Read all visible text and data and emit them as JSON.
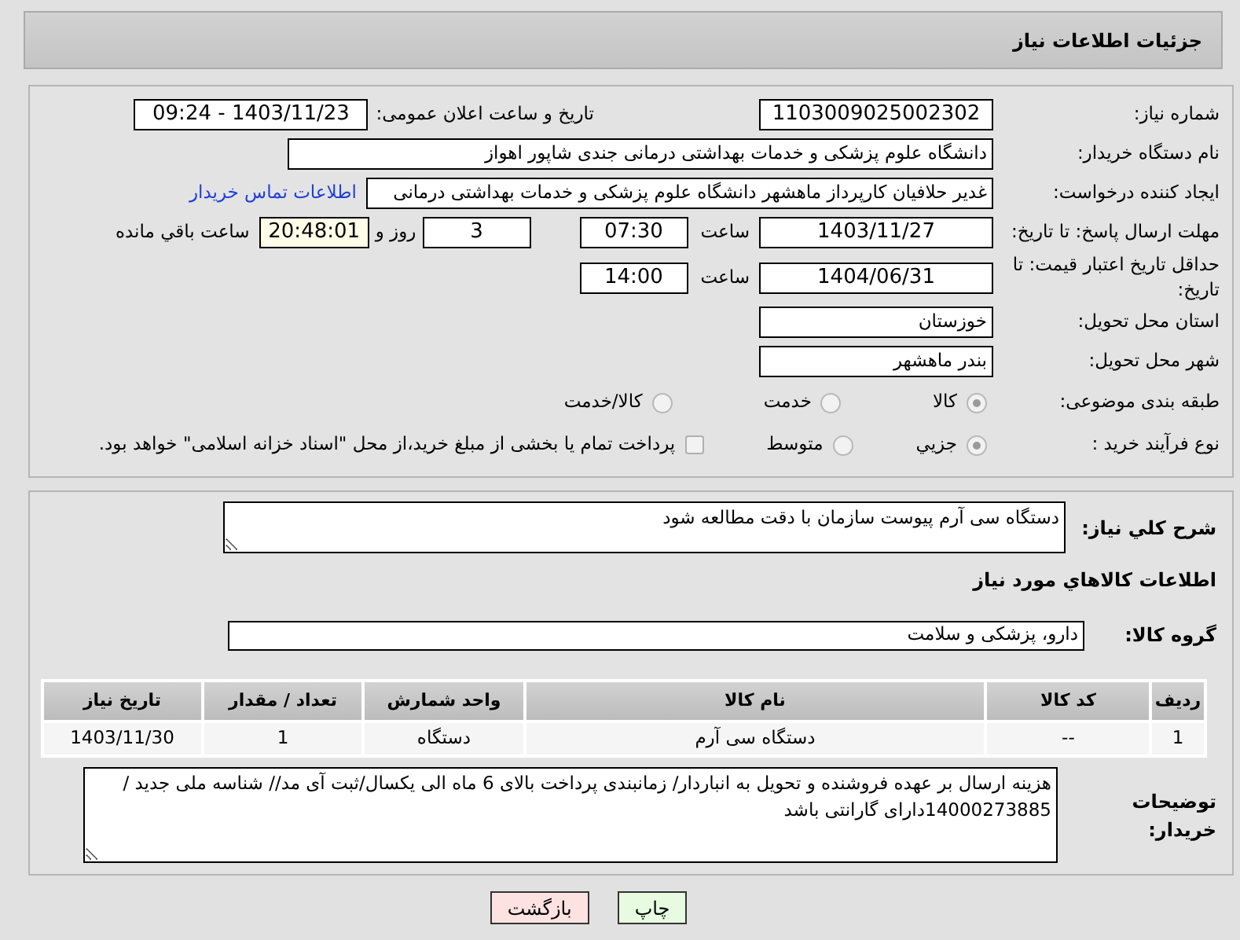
{
  "header": {
    "title": "جزئیات اطلاعات نیاز"
  },
  "need_number": {
    "label": "شماره نیاز:",
    "value": "1103009025002302"
  },
  "announce": {
    "label": "تاریخ و ساعت اعلان عمومی:",
    "value": "1403/11/23 - 09:24"
  },
  "buyer_org": {
    "label": "نام دستگاه خریدار:",
    "value": "دانشگاه علوم پزشکی و خدمات بهداشتی درمانی جندی شاپور اهواز"
  },
  "creator": {
    "label": "ایجاد کننده درخواست:",
    "value": "غدیر حلافیان کارپرداز ماهشهر دانشگاه علوم پزشکی و خدمات بهداشتی درمانی",
    "link": "اطلاعات تماس خریدار"
  },
  "reply_deadline": {
    "label": "مهلت ارسال پاسخ: تا تاریخ:",
    "date": "1403/11/27",
    "time_label": "ساعت",
    "time": "07:30",
    "days": "3",
    "days_label": "روز و",
    "remaining": "20:48:01",
    "remaining_label": "ساعت باقي مانده"
  },
  "price_validity": {
    "label": "حداقل تاریخ اعتبار قیمت: تا تاریخ:",
    "date": "1404/06/31",
    "time_label": "ساعت",
    "time": "14:00"
  },
  "province": {
    "label": "استان محل تحویل:",
    "value": "خوزستان"
  },
  "city": {
    "label": "شهر محل تحویل:",
    "value": "بندر ماهشهر"
  },
  "category": {
    "label": "طبقه بندی موضوعی:",
    "options": [
      {
        "label": "کالا",
        "selected": true
      },
      {
        "label": "خدمت",
        "selected": false
      },
      {
        "label": "کالا/خدمت",
        "selected": false
      }
    ]
  },
  "purchase_type": {
    "label": "نوع فرآیند خرید :",
    "options": [
      {
        "label": "جزیي",
        "selected": true
      },
      {
        "label": "متوسط",
        "selected": false
      }
    ],
    "treasury": {
      "label": "پرداخت تمام یا بخشی از مبلغ خرید،از محل \"اسناد خزانه اسلامی\" خواهد بود.",
      "checked": false
    }
  },
  "description": {
    "label": "شرح کلي نیاز:",
    "value": "دستگاه سی آرم پیوست سازمان با دقت مطالعه شود"
  },
  "items_heading": "اطلاعات كالاهاي مورد نیاز",
  "goods_group": {
    "label": "گروه کالا:",
    "value": "دارو، پزشکی و سلامت"
  },
  "table": {
    "columns": [
      "ردیف",
      "کد کالا",
      "نام کالا",
      "واحد شمارش",
      "تعداد / مقدار",
      "تاریخ نیاز"
    ],
    "rows": [
      [
        "1",
        "--",
        "دستگاه سی آرم",
        "دستگاه",
        "1",
        "1403/11/30"
      ]
    ]
  },
  "buyer_notes": {
    "label": "توضیحات خریدار:",
    "value": "هزینه ارسال بر عهده فروشنده و تحویل به انباردار/ زمانبندی پرداخت بالای 6 ماه الی یکسال/ثبت آی مد// شناسه ملی جدید / 14000273885دارای گارانتی باشد"
  },
  "buttons": [
    {
      "label": "چاپ",
      "kind": "print"
    },
    {
      "label": "بازگشت",
      "kind": "back"
    }
  ]
}
